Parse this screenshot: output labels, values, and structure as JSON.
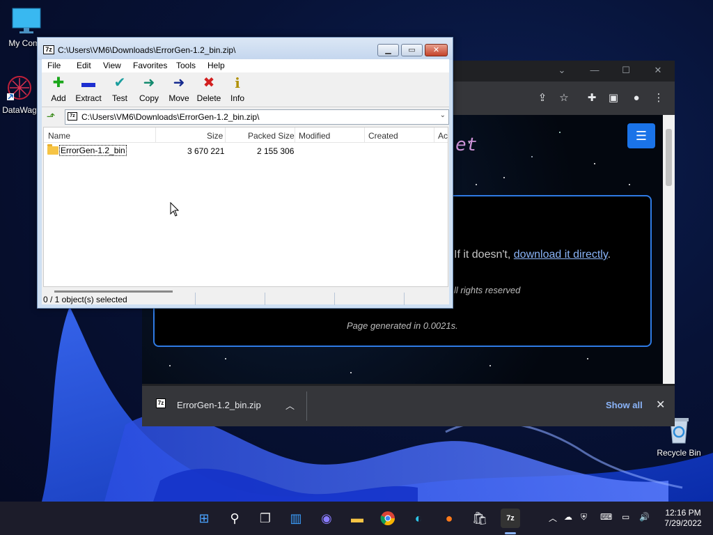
{
  "desktop": {
    "icons": [
      {
        "label": "My Comp",
        "icon": "computer-icon"
      },
      {
        "label": "DataWag",
        "icon": "datawag-icon"
      },
      {
        "label": "Recycle Bin",
        "icon": "recycle-bin-icon"
      }
    ]
  },
  "zip_window": {
    "title": "C:\\Users\\VM6\\Downloads\\ErrorGen-1.2_bin.zip\\",
    "menu": [
      "File",
      "Edit",
      "View",
      "Favorites",
      "Tools",
      "Help"
    ],
    "toolbar": [
      {
        "label": "Add",
        "icon": "add-icon",
        "color": "#1aa61a"
      },
      {
        "label": "Extract",
        "icon": "extract-icon",
        "color": "#1d2fd0"
      },
      {
        "label": "Test",
        "icon": "test-icon",
        "color": "#1b9e9e"
      },
      {
        "label": "Copy",
        "icon": "copy-icon",
        "color": "#138a6e"
      },
      {
        "label": "Move",
        "icon": "move-icon",
        "color": "#152a8f"
      },
      {
        "label": "Delete",
        "icon": "delete-icon",
        "color": "#d21f1f"
      },
      {
        "label": "Info",
        "icon": "info-icon",
        "color": "#b09000"
      }
    ],
    "address": "C:\\Users\\VM6\\Downloads\\ErrorGen-1.2_bin.zip\\",
    "columns": [
      "Name",
      "Size",
      "Packed Size",
      "Modified",
      "Created",
      "Ac"
    ],
    "rows": [
      {
        "name": "ErrorGen-1.2_bin",
        "size": "3 670 221",
        "packed": "2 155 306",
        "modified": "",
        "created": ""
      }
    ],
    "status": "0 / 1 object(s) selected"
  },
  "browser": {
    "site_title": "et",
    "paragraph_prefix": "If it doesn't, ",
    "paragraph_link": "download it directly",
    "paragraph_suffix": ".",
    "rights": "ll rights reserved",
    "generated": "Page generated in 0.0021s.",
    "download": {
      "filename": "ErrorGen-1.2_bin.zip",
      "show_all": "Show all"
    }
  },
  "taskbar": {
    "clock_time": "12:16 PM",
    "clock_date": "7/29/2022"
  }
}
